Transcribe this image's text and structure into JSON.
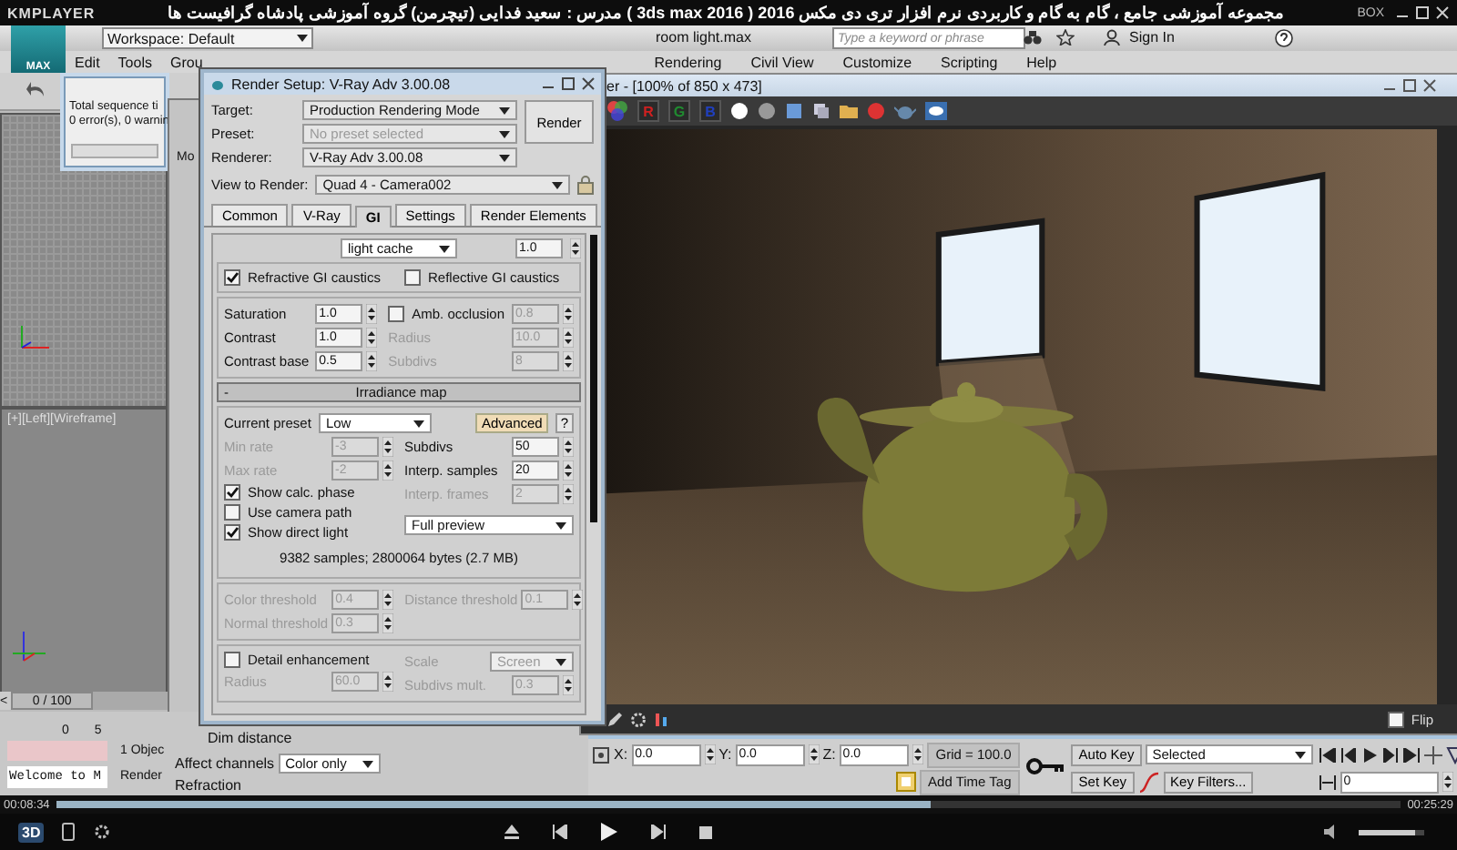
{
  "player": {
    "logo": "KMPLAYER",
    "title": "مجموعه آموزشی جامع ، گام به گام و کاربردی نرم افزار تری دی مکس 2016 ( 3ds max 2016 ) مدرس : سعید فدایی (تیچرمن) گروه آموزشی پادشاه گرافیست ها",
    "box_label": "BOX",
    "elapsed": "00:08:34",
    "total": "00:25:29",
    "seek": {
      "level": 0.65
    },
    "volume": {
      "level": 0.85
    },
    "badge": "3D"
  },
  "max": {
    "logo": "MAX",
    "workspace": "Workspace: Default",
    "file_title": "room light.max",
    "search": {
      "placeholder": "Type a keyword or phrase"
    },
    "sign_in": "Sign In",
    "menus_left": [
      "Edit",
      "Tools",
      "Grou"
    ],
    "menus_right": [
      "Rendering",
      "Civil View",
      "Customize",
      "Scripting",
      "Help"
    ],
    "listener": {
      "lines": [
        "Total sequence ti",
        "0 error(s), 0 warnin"
      ]
    },
    "material_editor_tab": "Mo",
    "viewport_label": "[+][Left][Wireframe]",
    "time_slider": {
      "prev": "<",
      "label": "0 / 100",
      "level": 0,
      "ticks": [
        "0",
        "5"
      ]
    },
    "status": {
      "objects": "1 Objec",
      "prompt": "Welcome to M",
      "render": "Render"
    },
    "lower_panel": {
      "dim_distance": "Dim distance",
      "affect_channels": "Affect channels",
      "channel_mode": "Color only",
      "refraction": "Refraction"
    },
    "coords": [
      {
        "axis": "X:",
        "value": "0.0"
      },
      {
        "axis": "Y:",
        "value": "0.0"
      },
      {
        "axis": "Z:",
        "value": "0.0"
      }
    ],
    "grid": "Grid = 100.0",
    "add_time_tag": "Add Time Tag",
    "auto_key": "Auto Key",
    "key_mode": "Selected",
    "set_key": "Set Key",
    "key_filters": "Key Filters...",
    "frame": "0"
  },
  "render_setup": {
    "title": "Render Setup: V-Ray Adv 3.00.08",
    "rows": [
      {
        "label": "Target:",
        "value": "Production Rendering Mode",
        "disabled": false
      },
      {
        "label": "Preset:",
        "value": "No preset selected",
        "disabled": true
      },
      {
        "label": "Renderer:",
        "value": "V-Ray Adv 3.00.08",
        "disabled": false
      }
    ],
    "render_button": "Render",
    "view_label": "View to Render:",
    "view_value": "Quad 4 - Camera002",
    "tabs": [
      {
        "label": "Common",
        "selected": false
      },
      {
        "label": "V-Ray",
        "selected": false
      },
      {
        "label": "GI",
        "selected": true
      },
      {
        "label": "Settings",
        "selected": false
      },
      {
        "label": "Render Elements",
        "selected": false
      }
    ],
    "gi": {
      "engine": "light cache",
      "multiplier": "1.0",
      "caustics": [
        {
          "label": "Refractive GI caustics",
          "checked": true
        },
        {
          "label": "Reflective GI caustics",
          "checked": false
        }
      ],
      "basic_left": [
        {
          "label": "Saturation",
          "value": "1.0",
          "disabled": false
        },
        {
          "label": "Contrast",
          "value": "1.0",
          "disabled": false
        },
        {
          "label": "Contrast base",
          "value": "0.5",
          "disabled": false
        }
      ],
      "ambient": {
        "label": "Amb. occlusion",
        "checked": false,
        "value": "0.8",
        "disabled": true
      },
      "basic_right": [
        {
          "label": "Radius",
          "value": "10.0",
          "disabled": true
        },
        {
          "label": "Subdivs",
          "value": "8",
          "disabled": true
        }
      ],
      "rollout": {
        "sign": "-",
        "title": "Irradiance map"
      },
      "preset": {
        "label": "Current preset",
        "value": "Low",
        "advanced": "Advanced",
        "help": "?"
      },
      "rates": [
        {
          "label": "Min rate",
          "value": "-3",
          "disabled": true
        },
        {
          "label": "Max rate",
          "value": "-2",
          "disabled": true
        }
      ],
      "samples": [
        {
          "label": "Subdivs",
          "value": "50",
          "disabled": false
        },
        {
          "label": "Interp. samples",
          "value": "20",
          "disabled": false
        },
        {
          "label": "Interp. frames",
          "value": "2",
          "disabled": true
        }
      ],
      "options": [
        {
          "label": "Show calc. phase",
          "checked": true
        },
        {
          "label": "Use camera path",
          "checked": false
        },
        {
          "label": "Show direct light",
          "checked": true
        }
      ],
      "preview_mode": "Full preview",
      "stats": "9382 samples; 2800064 bytes (2.7 MB)",
      "thresholds_left": [
        {
          "label": "Color threshold",
          "value": "0.4",
          "disabled": true
        },
        {
          "label": "Normal threshold",
          "value": "0.3",
          "disabled": true
        }
      ],
      "thresholds_right": [
        {
          "label": "Distance threshold",
          "value": "0.1",
          "disabled": true
        }
      ],
      "detail": {
        "label": "Detail enhancement",
        "checked": false,
        "scale_label": "Scale",
        "scale": "Screen",
        "disabled": true
      },
      "detail_fields": [
        {
          "label": "Radius",
          "value": "60.0",
          "disabled": true
        },
        {
          "label": "Subdivs mult.",
          "value": "0.3",
          "disabled": true
        }
      ]
    }
  },
  "frame_buffer": {
    "title": "er - [100% of 850 x 473]",
    "channels": [
      {
        "label": "R",
        "color": "#d02020"
      },
      {
        "label": "G",
        "color": "#208a30"
      },
      {
        "label": "B",
        "color": "#2040c0"
      }
    ],
    "flip": {
      "label": "Flip",
      "checked": false
    }
  }
}
